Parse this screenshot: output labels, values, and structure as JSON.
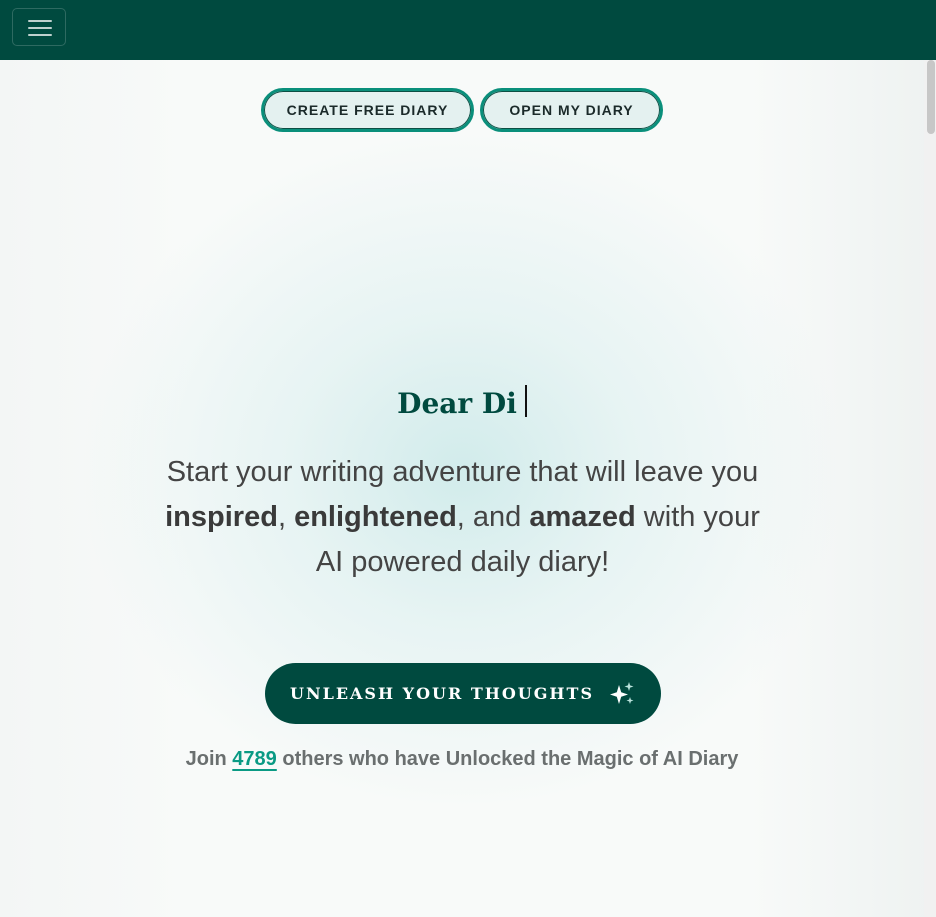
{
  "navbar": {
    "menu_icon": "hamburger-menu-icon",
    "background_color": "#004a3f"
  },
  "top_buttons": {
    "create_label": "CREATE FREE DIARY",
    "open_label": "OPEN MY DIARY",
    "border_color": "#0a8f7b"
  },
  "hero": {
    "headline": "Dear Di",
    "tagline": {
      "part1": "Start your writing adventure that will leave you ",
      "bold1": "inspired",
      "sep1": ", ",
      "bold2": "enlightened",
      "sep2": ", and ",
      "bold3": "amazed",
      "part2": " with your AI powered daily diary!"
    },
    "cta_label": "UNLEASH YOUR THOUGHTS",
    "cta_icon": "sparkle-icon",
    "join_prefix": "Join ",
    "join_count": "4789",
    "join_suffix": " others who have Unlocked the Magic of AI Diary"
  },
  "colors": {
    "brand_dark": "#004a3f",
    "accent": "#0a9a84",
    "text": "#444444"
  }
}
